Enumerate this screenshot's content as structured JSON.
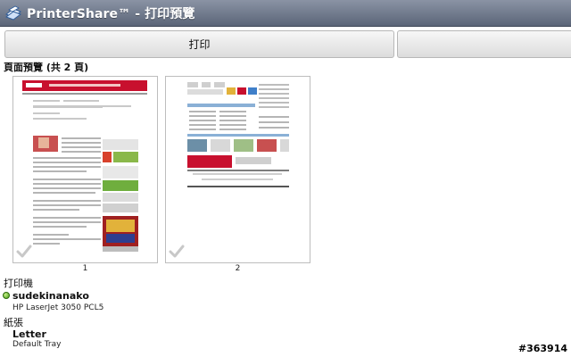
{
  "app": {
    "title": "PrinterShare™ - 打印預覽",
    "icon": "printershare-app-icon"
  },
  "toolbar": {
    "print_label": "打印",
    "second_button_label": ""
  },
  "preview": {
    "heading": "頁面預覽 (共 2 頁)",
    "pages": [
      {
        "number": "1",
        "selected_icon": "checkmark-icon"
      },
      {
        "number": "2",
        "selected_icon": "checkmark-icon"
      }
    ]
  },
  "printer": {
    "heading": "打印機",
    "name": "sudekinanako",
    "model": "HP LaserJet 3050 PCL5",
    "status_color": "#3f9a12"
  },
  "paper": {
    "heading": "紙張",
    "size": "Letter",
    "tray": "Default Tray"
  },
  "overlay": {
    "watermark": "#363914"
  },
  "colors": {
    "titlebar_top": "#8a93a4",
    "titlebar_bottom": "#5b6578",
    "thumbnail_accent": "#c8102e"
  }
}
